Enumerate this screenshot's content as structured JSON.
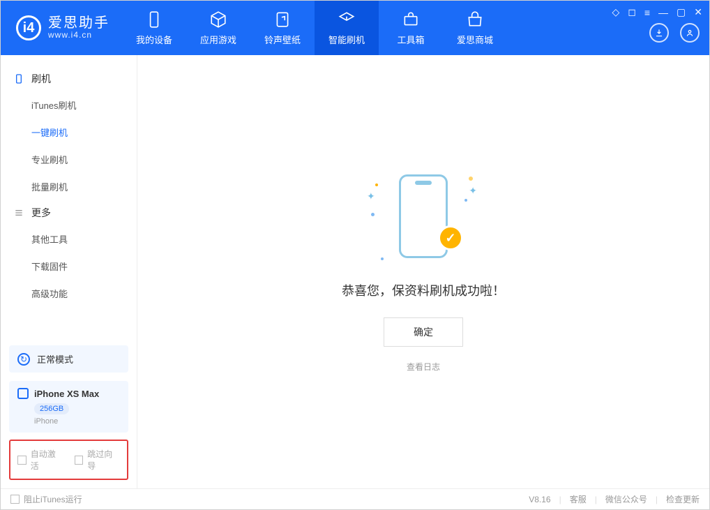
{
  "app": {
    "name_cn": "爱思助手",
    "name_en": "www.i4.cn"
  },
  "topTabs": [
    {
      "label": "我的设备",
      "icon": "device"
    },
    {
      "label": "应用游戏",
      "icon": "cube"
    },
    {
      "label": "铃声壁纸",
      "icon": "music"
    },
    {
      "label": "智能刷机",
      "icon": "refresh"
    },
    {
      "label": "工具箱",
      "icon": "toolbox"
    },
    {
      "label": "爱思商城",
      "icon": "shop"
    }
  ],
  "sidebar": {
    "section1": {
      "title": "刷机",
      "items": [
        "iTunes刷机",
        "一键刷机",
        "专业刷机",
        "批量刷机"
      ]
    },
    "section2": {
      "title": "更多",
      "items": [
        "其他工具",
        "下载固件",
        "高级功能"
      ]
    }
  },
  "modeBox": {
    "label": "正常模式"
  },
  "deviceBox": {
    "name": "iPhone XS Max",
    "storage": "256GB",
    "type": "iPhone"
  },
  "bottomChecks": {
    "auto_activate": "自动激活",
    "skip_guide": "跳过向导"
  },
  "main": {
    "success_text": "恭喜您，保资料刷机成功啦！",
    "confirm_label": "确定",
    "log_link": "查看日志"
  },
  "footer": {
    "block_itunes": "阻止iTunes运行",
    "version": "V8.16",
    "support": "客服",
    "wechat": "微信公众号",
    "check_update": "检查更新"
  }
}
